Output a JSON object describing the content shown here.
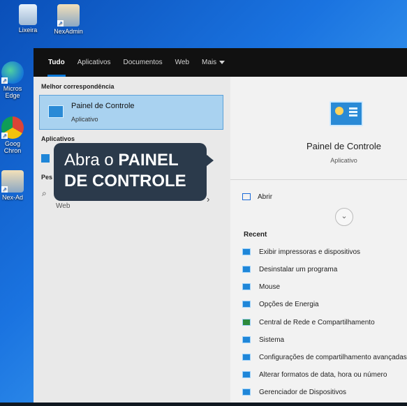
{
  "desktop": {
    "icons": [
      {
        "label": "Lixeira",
        "icon": "recycle-bin-icon"
      },
      {
        "label": "NexAdmin",
        "icon": "network-people-icon"
      },
      {
        "label": "Micros Edge",
        "icon": "edge-icon"
      },
      {
        "label": "Goog Chron",
        "icon": "chrome-icon"
      },
      {
        "label": "Nex-Ad",
        "icon": "network-people-icon"
      }
    ]
  },
  "tabs": [
    "Tudo",
    "Aplicativos",
    "Documentos",
    "Web",
    "Mais"
  ],
  "left": {
    "best_heading": "Melhor correspondência",
    "best_title": "Painel de Controle",
    "best_sub": "Aplicativo",
    "apps_heading": "Aplicativos",
    "search_heading": "Pes",
    "web_label": "Web"
  },
  "right": {
    "title": "Painel de Controle",
    "subtitle": "Aplicativo",
    "open_label": "Abrir",
    "recent_heading": "Recent",
    "recent_items": [
      "Exibir impressoras e dispositivos",
      "Desinstalar um programa",
      "Mouse",
      "Opções de Energia",
      "Central de Rede e Compartilhamento",
      "Sistema",
      "Configurações de compartilhamento avançadas",
      "Alterar formatos de data, hora ou número",
      "Gerenciador de Dispositivos"
    ]
  },
  "callout": {
    "line1_plain": "Abra o ",
    "line1_bold": "PAINEL",
    "line2_bold": "DE CONTROLE"
  }
}
